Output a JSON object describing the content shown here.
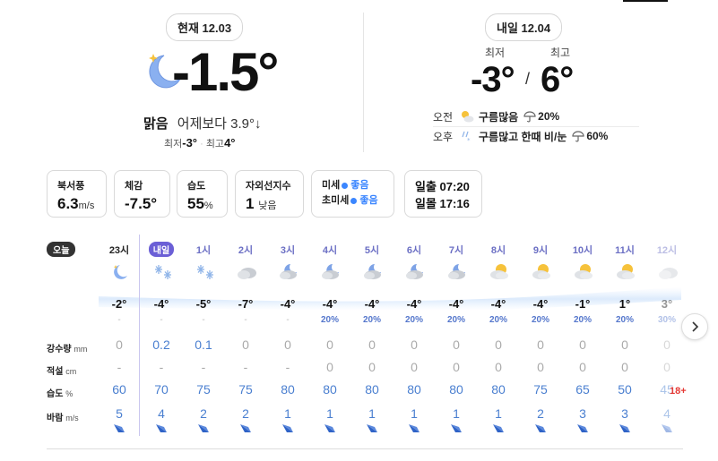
{
  "current": {
    "date_label": "현재 12.03",
    "temperature": "-1.5°",
    "condition": "맑음",
    "compare": "어제보다 3.9°↓",
    "min_label": "최저",
    "min": "-3°",
    "max_label": "최고",
    "max": "4°",
    "icon": "moon-star-icon"
  },
  "tomorrow": {
    "date_label": "내일 12.04",
    "min_label": "최저",
    "max_label": "최고",
    "min": "-3°",
    "slash": "/",
    "max": "6°",
    "am": {
      "label": "오전",
      "weather": "구름많음",
      "pop": "20%",
      "icon": "partly-cloudy-icon"
    },
    "pm": {
      "label": "오후",
      "weather": "구름많고 한때 비/눈",
      "pop": "60%",
      "icon": "rain-snow-icon"
    }
  },
  "cards": {
    "wind": {
      "title": "북서풍",
      "value": "6.3",
      "unit": "m/s"
    },
    "feels": {
      "title": "체감",
      "value": "-7.5°"
    },
    "humidity": {
      "title": "습도",
      "value": "55",
      "unit": "%"
    },
    "uv": {
      "title": "자외선지수",
      "value": "1",
      "level": "낮음"
    },
    "dust": {
      "pm10_label": "미세",
      "pm10": "좋음",
      "pm25_label": "초미세",
      "pm25": "좋음"
    },
    "sun": {
      "rise_label": "일출",
      "rise": "07:20",
      "set_label": "일몰",
      "set": "17:16"
    }
  },
  "hourly": {
    "today_label": "오늘",
    "row_labels": {
      "rain": "강수량",
      "rain_unit": "mm",
      "snow": "적설",
      "snow_unit": "cm",
      "humidity": "습도",
      "humidity_unit": "%",
      "wind": "바람",
      "wind_unit": "m/s"
    },
    "hours": [
      {
        "time": "23시",
        "icon": "night-moon",
        "temp": "-2°",
        "pop": "-",
        "rain": "0",
        "snow": "-",
        "hum": "60",
        "wind": "5"
      },
      {
        "time": "내일",
        "icon": "snow",
        "temp": "-4°",
        "pop": "-",
        "rain": "0.2",
        "snow": "-",
        "hum": "70",
        "wind": "4"
      },
      {
        "time": "1시",
        "icon": "snow",
        "temp": "-5°",
        "pop": "-",
        "rain": "0.1",
        "snow": "-",
        "hum": "75",
        "wind": "2"
      },
      {
        "time": "2시",
        "icon": "cloud",
        "temp": "-7°",
        "pop": "-",
        "rain": "0",
        "snow": "-",
        "hum": "75",
        "wind": "2"
      },
      {
        "time": "3시",
        "icon": "night-cloud",
        "temp": "-4°",
        "pop": "-",
        "rain": "0",
        "snow": "-",
        "hum": "80",
        "wind": "1"
      },
      {
        "time": "4시",
        "icon": "night-cloud",
        "temp": "-4°",
        "pop": "20%",
        "rain": "0",
        "snow": "0",
        "hum": "80",
        "wind": "1"
      },
      {
        "time": "5시",
        "icon": "night-cloud",
        "temp": "-4°",
        "pop": "20%",
        "rain": "0",
        "snow": "0",
        "hum": "80",
        "wind": "1"
      },
      {
        "time": "6시",
        "icon": "night-cloud",
        "temp": "-4°",
        "pop": "20%",
        "rain": "0",
        "snow": "0",
        "hum": "80",
        "wind": "1"
      },
      {
        "time": "7시",
        "icon": "night-cloud",
        "temp": "-4°",
        "pop": "20%",
        "rain": "0",
        "snow": "0",
        "hum": "80",
        "wind": "1"
      },
      {
        "time": "8시",
        "icon": "day-cloud",
        "temp": "-4°",
        "pop": "20%",
        "rain": "0",
        "snow": "0",
        "hum": "80",
        "wind": "1"
      },
      {
        "time": "9시",
        "icon": "day-cloud",
        "temp": "-4°",
        "pop": "20%",
        "rain": "0",
        "snow": "0",
        "hum": "75",
        "wind": "2"
      },
      {
        "time": "10시",
        "icon": "day-cloud",
        "temp": "-1°",
        "pop": "20%",
        "rain": "0",
        "snow": "0",
        "hum": "65",
        "wind": "3"
      },
      {
        "time": "11시",
        "icon": "day-cloud",
        "temp": "1°",
        "pop": "20%",
        "rain": "0",
        "snow": "0",
        "hum": "50",
        "wind": "3"
      },
      {
        "time": "12시",
        "icon": "cloud",
        "temp": "3°",
        "pop": "30%",
        "rain": "0",
        "snow": "0",
        "hum": "45",
        "wind": "4"
      }
    ]
  },
  "badge": "18+",
  "colors": {
    "accent": "#6b5fd6",
    "blue": "#4a7fd0",
    "good": "#3b86ff"
  }
}
